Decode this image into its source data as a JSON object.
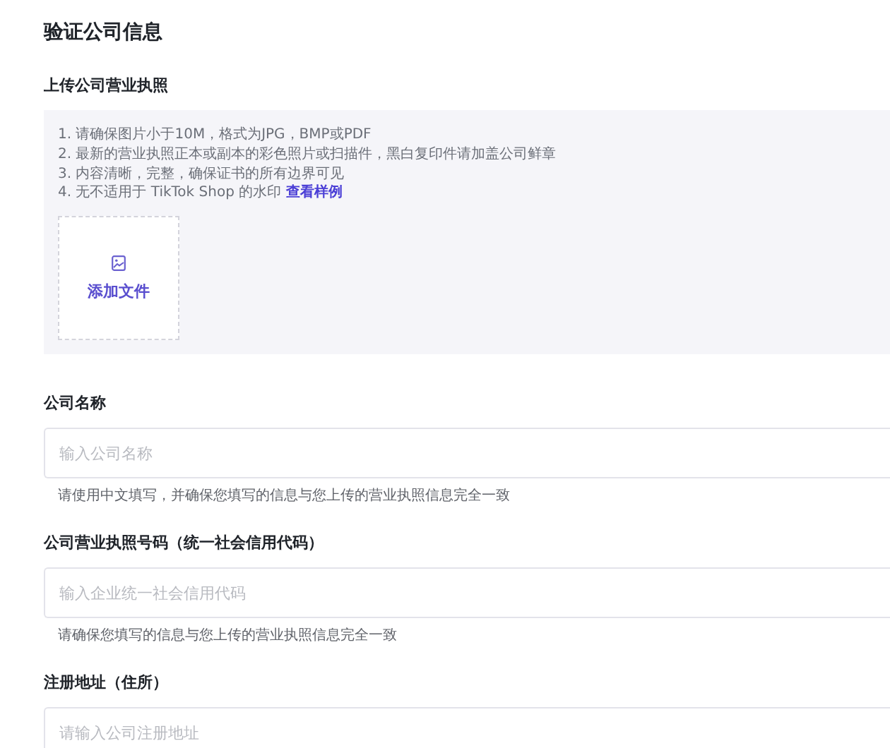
{
  "title": "验证公司信息",
  "upload": {
    "label": "上传公司营业执照",
    "instructions": [
      "1. 请确保图片小于10M，格式为JPG，BMP或PDF",
      "2. 最新的营业执照正本或副本的彩色照片或扫描件，黑白复印件请加盖公司鲜章",
      "3. 内容清晰，完整，确保证书的所有边界可见",
      "4. 无不适用于 TikTok Shop 的水印"
    ],
    "sample_link": "查看样例",
    "button": "添加文件"
  },
  "fields": [
    {
      "label": "公司名称",
      "placeholder": "输入公司名称",
      "hint": "请使用中文填写，并确保您填写的信息与您上传的营业执照信息完全一致"
    },
    {
      "label": "公司营业执照号码（统一社会信用代码）",
      "placeholder": "输入企业统一社会信用代码",
      "hint": "请确保您填写的信息与您上传的营业执照信息完全一致"
    },
    {
      "label": "注册地址（住所）",
      "placeholder": "请输入公司注册地址"
    }
  ]
}
